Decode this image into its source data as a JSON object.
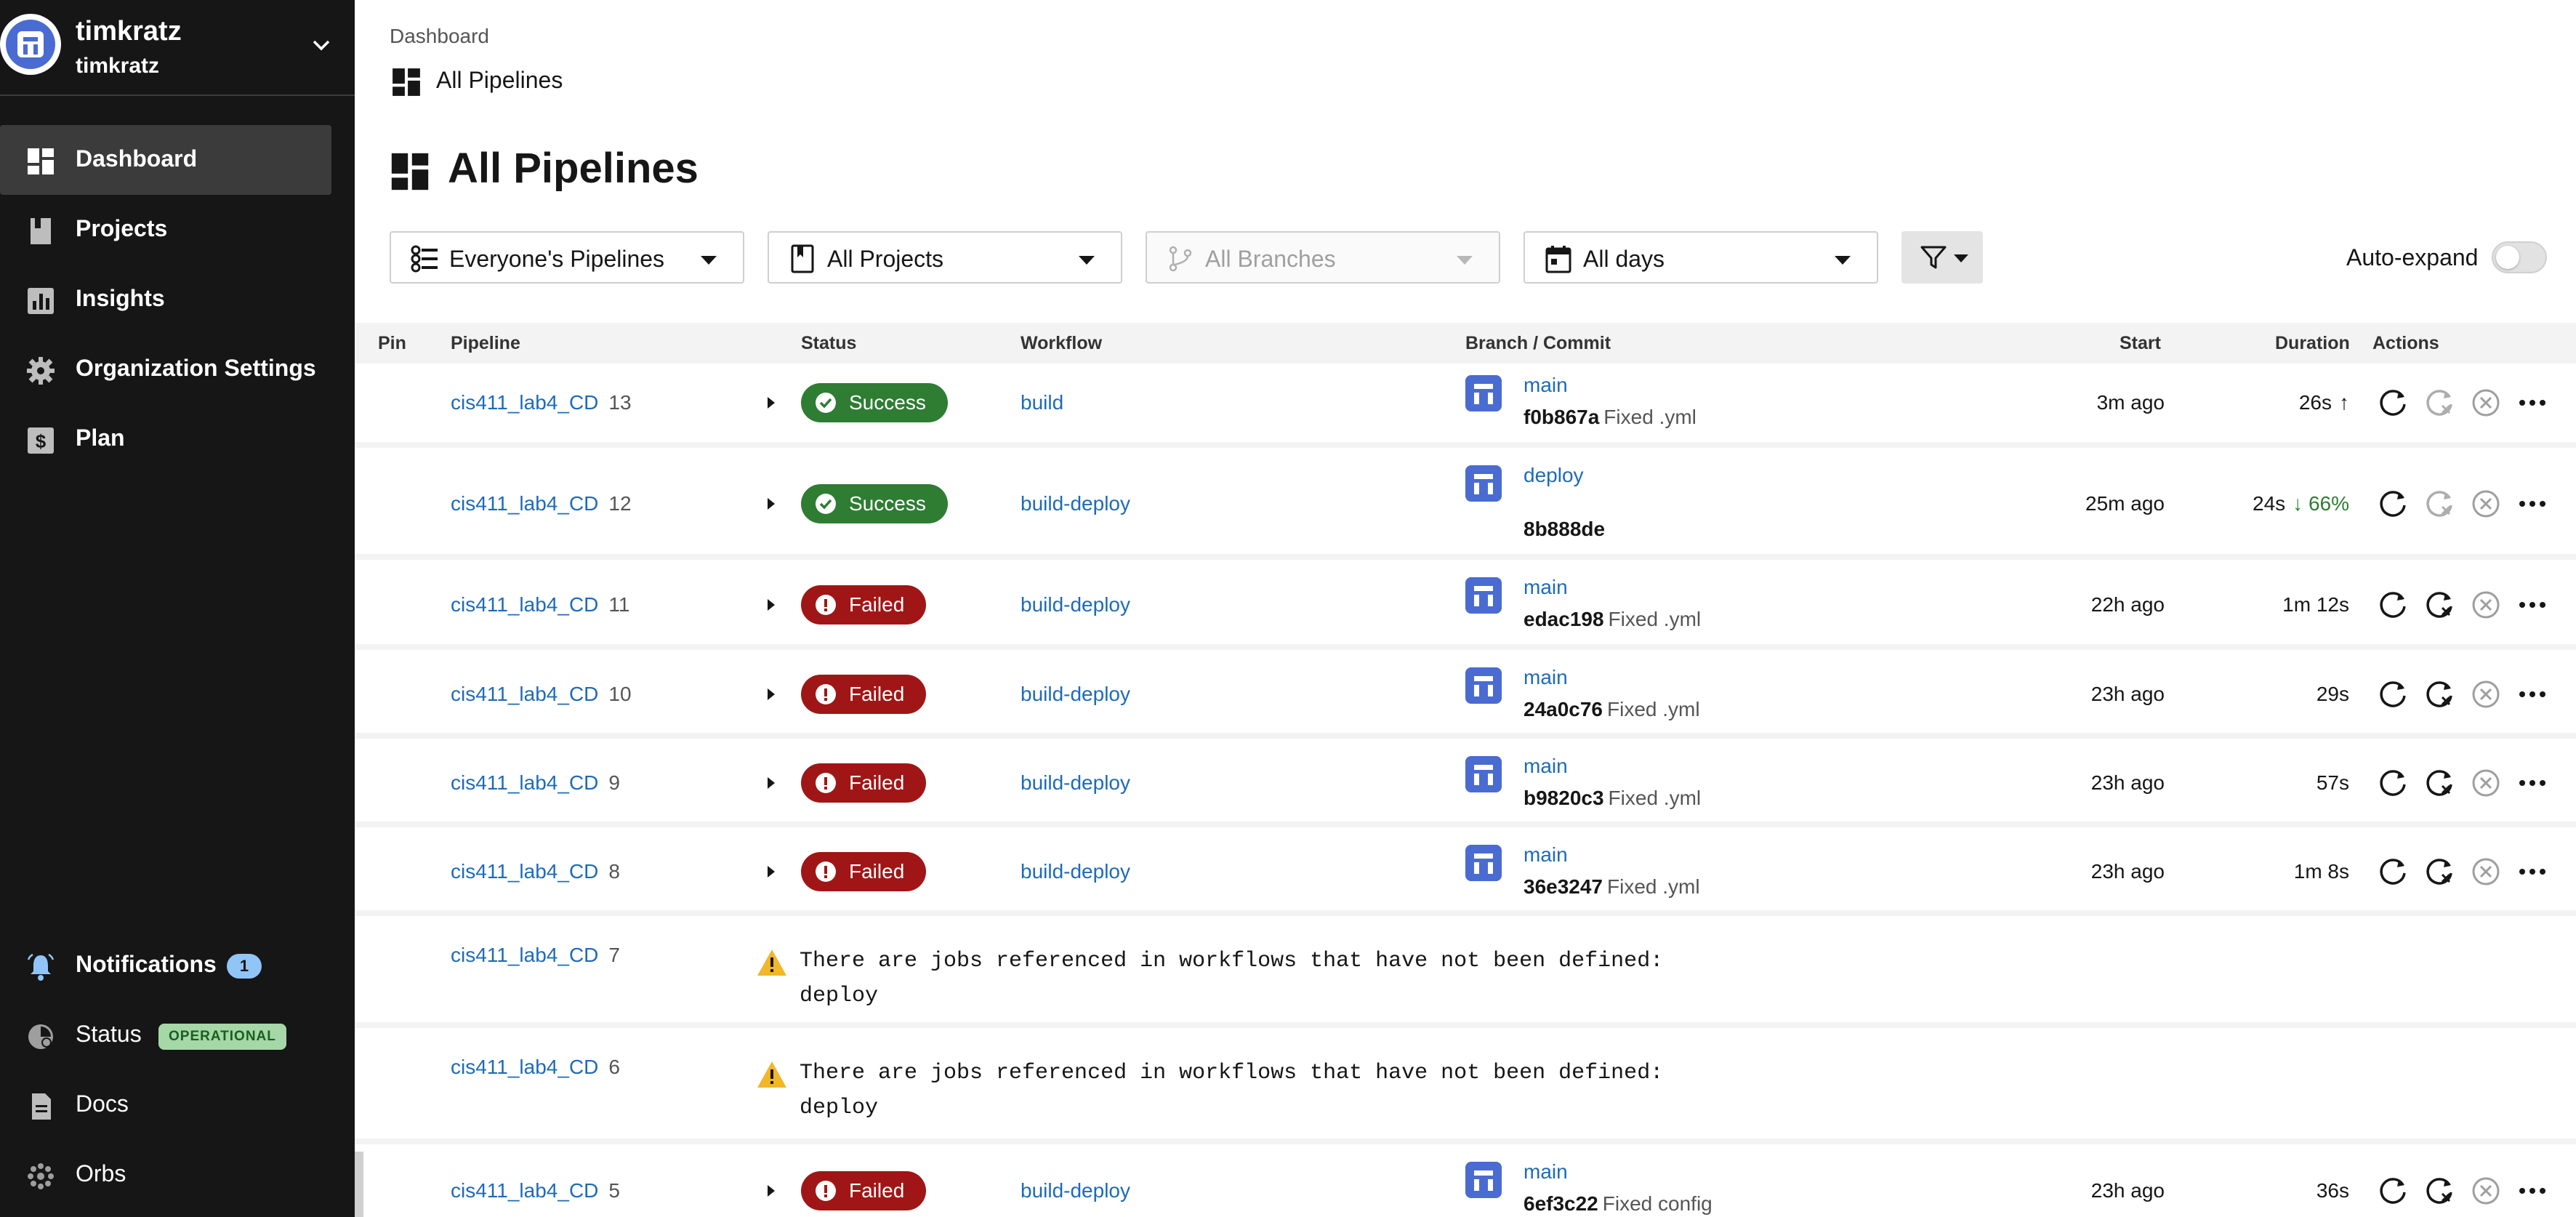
{
  "org": {
    "name": "timkratz",
    "user": "timkratz"
  },
  "nav": [
    {
      "label": "Dashboard",
      "icon": "dashboard-icon",
      "active": true
    },
    {
      "label": "Projects",
      "icon": "projects-icon"
    },
    {
      "label": "Insights",
      "icon": "insights-icon"
    },
    {
      "label": "Organization Settings",
      "icon": "gear-icon"
    },
    {
      "label": "Plan",
      "icon": "dollar-icon"
    }
  ],
  "bottom_nav": {
    "notifications": {
      "label": "Notifications",
      "count": "1"
    },
    "status": {
      "label": "Status",
      "badge": "OPERATIONAL"
    },
    "docs": {
      "label": "Docs"
    },
    "orbs": {
      "label": "Orbs"
    }
  },
  "header": {
    "breadcrumb": "Dashboard",
    "subtitle": "All Pipelines",
    "title": "All Pipelines"
  },
  "filters": {
    "pipelines": "Everyone's Pipelines",
    "projects": "All Projects",
    "branches": "All Branches",
    "days": "All days",
    "auto_expand": "Auto-expand"
  },
  "columns": {
    "pin": "Pin",
    "pipeline": "Pipeline",
    "status": "Status",
    "workflow": "Workflow",
    "branch_commit": "Branch / Commit",
    "start": "Start",
    "duration": "Duration",
    "actions": "Actions"
  },
  "rows": [
    {
      "name": "cis411_lab4_CD",
      "num": "13",
      "status": "Success",
      "workflow": "build",
      "branch": "main",
      "hash": "f0b867a",
      "msg": "Fixed .yml",
      "start": "3m ago",
      "duration": "26s",
      "dur_change": "↑"
    },
    {
      "name": "cis411_lab4_CD",
      "num": "12",
      "status": "Success",
      "workflow": "build-deploy",
      "branch": "deploy",
      "hash": "8b888de",
      "msg": "",
      "start": "25m ago",
      "duration": "24s",
      "dur_change": "↓ 66%"
    },
    {
      "name": "cis411_lab4_CD",
      "num": "11",
      "status": "Failed",
      "workflow": "build-deploy",
      "branch": "main",
      "hash": "edac198",
      "msg": "Fixed .yml",
      "start": "22h ago",
      "duration": "1m 12s"
    },
    {
      "name": "cis411_lab4_CD",
      "num": "10",
      "status": "Failed",
      "workflow": "build-deploy",
      "branch": "main",
      "hash": "24a0c76",
      "msg": "Fixed .yml",
      "start": "23h ago",
      "duration": "29s"
    },
    {
      "name": "cis411_lab4_CD",
      "num": "9",
      "status": "Failed",
      "workflow": "build-deploy",
      "branch": "main",
      "hash": "b9820c3",
      "msg": "Fixed .yml",
      "start": "23h ago",
      "duration": "57s"
    },
    {
      "name": "cis411_lab4_CD",
      "num": "8",
      "status": "Failed",
      "workflow": "build-deploy",
      "branch": "main",
      "hash": "36e3247",
      "msg": "Fixed .yml",
      "start": "23h ago",
      "duration": "1m 8s"
    },
    {
      "name": "cis411_lab4_CD",
      "num": "7",
      "warning": "There are jobs referenced in workflows that have not been defined:\ndeploy"
    },
    {
      "name": "cis411_lab4_CD",
      "num": "6",
      "warning": "There are jobs referenced in workflows that have not been defined:\ndeploy"
    },
    {
      "name": "cis411_lab4_CD",
      "num": "5",
      "status": "Failed",
      "workflow": "build-deploy",
      "branch": "main",
      "hash": "6ef3c22",
      "msg": "Fixed config",
      "start": "23h ago",
      "duration": "36s"
    }
  ],
  "colors": {
    "sidebar": "#161616",
    "link": "#1e6bb8",
    "success": "#2e7d32",
    "failed": "#a01616",
    "avatar": "#4a6bd1"
  }
}
